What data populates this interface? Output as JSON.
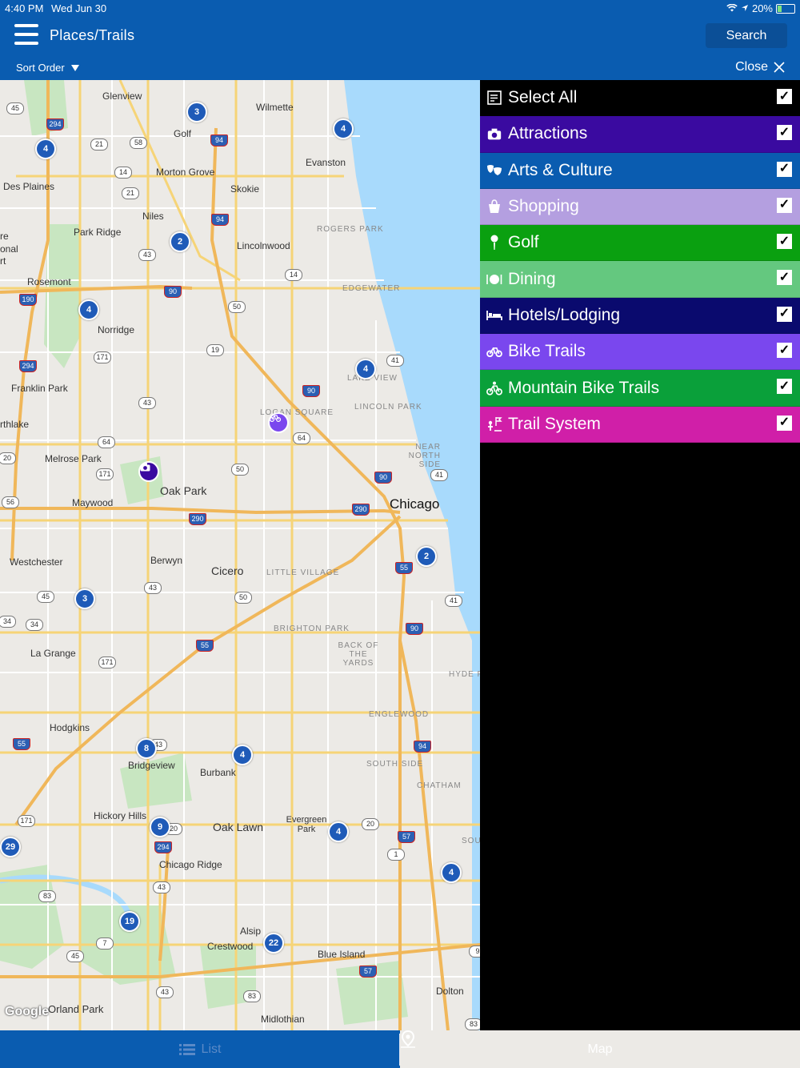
{
  "status_bar": {
    "time": "4:40 PM",
    "date": "Wed Jun 30",
    "battery": "20%"
  },
  "header": {
    "title": "Places/Trails",
    "search_label": "Search"
  },
  "subheader": {
    "sort_label": "Sort Order",
    "close_label": "Close"
  },
  "map": {
    "place_labels": [
      "Glenview",
      "Wilmette",
      "Golf",
      "Evanston",
      "Morton Grove",
      "Skokie",
      "Des Plaines",
      "Niles",
      "Park Ridge",
      "Lincolnwood",
      "Rosemont",
      "Norridge",
      "Franklin Park",
      "Melrose Park",
      "Oak Park",
      "Maywood",
      "Chicago",
      "Westchester",
      "Berwyn",
      "Cicero",
      "La Grange",
      "Hodgkins",
      "Bridgeview",
      "Burbank",
      "Hickory Hills",
      "Oak Lawn",
      "Evergreen Park",
      "Chicago Ridge",
      "Alsip",
      "Crestwood",
      "Blue Island",
      "Orland Park",
      "Midlothian",
      "Dolton",
      "rthlake",
      "onal",
      "rt",
      "re"
    ],
    "district_labels": [
      "ROGERS PARK",
      "EDGEWATER",
      "LAKE VIEW",
      "LINCOLN PARK",
      "LOGAN SQUARE",
      "NEAR NORTH SIDE",
      "LITTLE VILLAGE",
      "BRIGHTON PARK",
      "BACK OF THE YARDS",
      "HYDE P",
      "ENGLEWOOD",
      "SOUTH SIDE",
      "CHATHAM",
      "SOU"
    ],
    "route_shields": [
      "45",
      "294",
      "21",
      "58",
      "94",
      "14",
      "21",
      "94",
      "43",
      "14",
      "190",
      "90",
      "50",
      "171",
      "19",
      "294",
      "41",
      "90",
      "43",
      "64",
      "64",
      "20",
      "171",
      "50",
      "90",
      "41",
      "56",
      "290",
      "290",
      "55",
      "45",
      "43",
      "50",
      "41",
      "34",
      "34",
      "90",
      "55",
      "171",
      "55",
      "43",
      "94",
      "171",
      "20",
      "20",
      "57",
      "294",
      "1",
      "83",
      "43",
      "7",
      "45",
      "57",
      "43",
      "83",
      "83",
      "9"
    ],
    "clusters": [
      "3",
      "4",
      "4",
      "2",
      "4",
      "4",
      "2",
      "3",
      "8",
      "4",
      "9",
      "4",
      "4",
      "29",
      "19",
      "22"
    ],
    "poi_markers": [
      "bike-trail-poi",
      "attraction-poi"
    ],
    "attribution": "Google"
  },
  "filter_panel": {
    "items": [
      {
        "label": "Select All",
        "icon": "list-check-icon",
        "color": "#000000",
        "checked": true
      },
      {
        "label": "Attractions",
        "icon": "camera-icon",
        "color": "#3a0aa0",
        "checked": true
      },
      {
        "label": "Arts & Culture",
        "icon": "masks-icon",
        "color": "#0a5cb0",
        "checked": true
      },
      {
        "label": "Shopping",
        "icon": "shopping-bag-icon",
        "color": "#b49fe0",
        "checked": true
      },
      {
        "label": "Golf",
        "icon": "golf-tee-icon",
        "color": "#0aa010",
        "checked": true
      },
      {
        "label": "Dining",
        "icon": "plate-icon",
        "color": "#64c87f",
        "checked": true
      },
      {
        "label": "Hotels/Lodging",
        "icon": "bed-icon",
        "color": "#0a0a6e",
        "checked": true
      },
      {
        "label": "Bike Trails",
        "icon": "bicycle-icon",
        "color": "#7a47ee",
        "checked": true
      },
      {
        "label": "Mountain Bike Trails",
        "icon": "mountain-bike-icon",
        "color": "#0aa03a",
        "checked": true
      },
      {
        "label": "Trail System",
        "icon": "trail-sign-icon",
        "color": "#d01fa8",
        "checked": true
      }
    ]
  },
  "tabbar": {
    "list_label": "List",
    "map_label": "Map"
  }
}
